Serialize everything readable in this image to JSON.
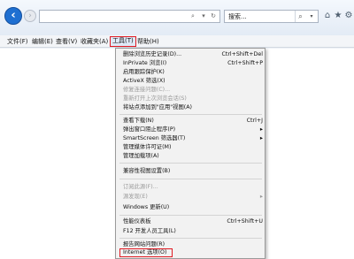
{
  "toolbar": {
    "back_icon": "back-arrow-icon",
    "forward_icon": "forward-arrow-icon",
    "address_value": "",
    "address_ctrl_search": "⌕",
    "address_ctrl_drop": "▾",
    "address_ctrl_refresh": "↻",
    "search_value": "搜索...",
    "search_glyph": "⌕",
    "search_drop_glyph": "▾",
    "home_glyph": "⌂",
    "favorites_glyph": "★",
    "settings_glyph": "⚙",
    "accent": "#1e6fd1"
  },
  "menubar": {
    "file": "文件(F)",
    "edit": "编辑(E)",
    "view": "查看(V)",
    "favorites": "收藏夹(A)",
    "tools": "工具(T)",
    "help": "帮助(H)",
    "highlight_color": "#e01a22"
  },
  "tools_menu": {
    "items": [
      {
        "label": "删除浏览历史记录(D)...",
        "shortcut": "Ctrl+Shift+Del",
        "disabled": false
      },
      {
        "label": "InPrivate 浏览(I)",
        "shortcut": "Ctrl+Shift+P",
        "disabled": false
      },
      {
        "label": "启用跟踪保护(K)",
        "shortcut": "",
        "disabled": false
      },
      {
        "label": "ActiveX 筛选(X)",
        "shortcut": "",
        "disabled": false
      },
      {
        "label": "修复连接问题(C)...",
        "shortcut": "",
        "disabled": true
      },
      {
        "label": "重新打开上次浏览会话(S)",
        "shortcut": "",
        "disabled": true
      },
      {
        "label": "将站点添加到\"应用\"视图(A)",
        "shortcut": "",
        "disabled": false
      },
      {
        "label": "查看下载(N)",
        "shortcut": "Ctrl+J",
        "disabled": false
      },
      {
        "label": "弹出窗口阻止程序(P)",
        "shortcut": "▸",
        "disabled": false
      },
      {
        "label": "SmartScreen 筛选器(T)",
        "shortcut": "▸",
        "disabled": false
      },
      {
        "label": "管理媒体许可证(M)",
        "shortcut": "",
        "disabled": false
      },
      {
        "label": "管理加载项(A)",
        "shortcut": "",
        "disabled": false
      },
      {
        "label": "兼容性视图设置(B)",
        "shortcut": "",
        "disabled": false
      },
      {
        "label": "订阅此源(F)...",
        "shortcut": "",
        "disabled": true
      },
      {
        "label": "源发现(E)",
        "shortcut": "▸",
        "disabled": true
      },
      {
        "label": "Windows 更新(U)",
        "shortcut": "",
        "disabled": false
      },
      {
        "label": "性能仪表板",
        "shortcut": "Ctrl+Shift+U",
        "disabled": false
      },
      {
        "label": "F12 开发人员工具(L)",
        "shortcut": "",
        "disabled": false
      },
      {
        "label": "报告网站问题(R)",
        "shortcut": "",
        "disabled": false
      },
      {
        "label": "Internet 选项(O)",
        "shortcut": "",
        "disabled": false
      }
    ]
  }
}
